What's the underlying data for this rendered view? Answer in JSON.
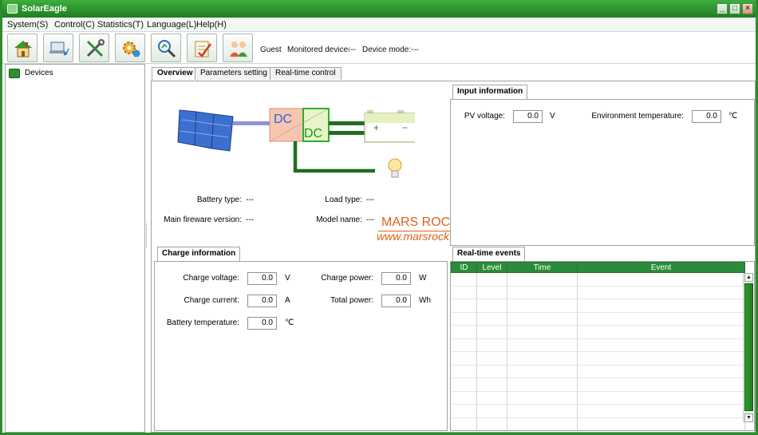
{
  "window": {
    "title": "SolarEagle"
  },
  "menu": {
    "items": [
      {
        "label": "System(S)"
      },
      {
        "label": "Control(C)"
      },
      {
        "label": "Statistics(T)"
      },
      {
        "label": "Language(L)"
      },
      {
        "label": "Help(H)"
      }
    ]
  },
  "toolbar": {
    "buttons": [
      {
        "icon": "home-icon"
      },
      {
        "icon": "device-connect-icon"
      },
      {
        "icon": "tools-icon"
      },
      {
        "icon": "settings-gear-icon"
      },
      {
        "icon": "search-chart-icon"
      },
      {
        "icon": "checklist-icon"
      },
      {
        "icon": "users-icon"
      }
    ],
    "user": "Guest",
    "monitored_device_label": "Monitored device:",
    "monitored_device_value": "---",
    "device_mode_label": "Device mode:",
    "device_mode_value": "---"
  },
  "tree": {
    "root_label": "Devices"
  },
  "tabs": [
    {
      "label": "Overview",
      "active": true
    },
    {
      "label": "Parameters setting",
      "active": false
    },
    {
      "label": "Real-time control",
      "active": false
    }
  ],
  "diagram": {
    "converter_text_1": "DC",
    "converter_text_2": "DC",
    "battery_plus": "+",
    "battery_minus": "−"
  },
  "device_info": {
    "battery_type_label": "Battery type:",
    "battery_type_value": "---",
    "load_type_label": "Load type:",
    "load_type_value": "---",
    "firmware_label": "Main fireware version:",
    "firmware_value": "---",
    "model_label": "Model name:",
    "model_value": "---"
  },
  "watermark": {
    "line1": "MARS ROCK SOLAR",
    "line2": "www.marsrock.com.cn"
  },
  "input_info": {
    "title": "Input information",
    "pv_voltage_label": "PV voltage:",
    "pv_voltage_value": "0.0",
    "pv_voltage_unit": "V",
    "env_temp_label": "Environment temperature:",
    "env_temp_value": "0.0",
    "env_temp_unit": "℃"
  },
  "charge_info": {
    "title": "Charge information",
    "charge_voltage_label": "Charge voltage:",
    "charge_voltage_value": "0.0",
    "charge_voltage_unit": "V",
    "charge_current_label": "Charge current:",
    "charge_current_value": "0.0",
    "charge_current_unit": "A",
    "battery_temp_label": "Battery temperature:",
    "battery_temp_value": "0.0",
    "battery_temp_unit": "℃",
    "charge_power_label": "Charge power:",
    "charge_power_value": "0.0",
    "charge_power_unit": "W",
    "total_power_label": "Total power:",
    "total_power_value": "0.0",
    "total_power_unit": "Wh"
  },
  "events": {
    "title": "Real-time events",
    "columns": [
      "ID",
      "Level",
      "Time",
      "Event"
    ],
    "rows": []
  },
  "colors": {
    "accent": "#2d8a2d",
    "header": "#2a8c3a",
    "watermark": "#e0621a"
  }
}
